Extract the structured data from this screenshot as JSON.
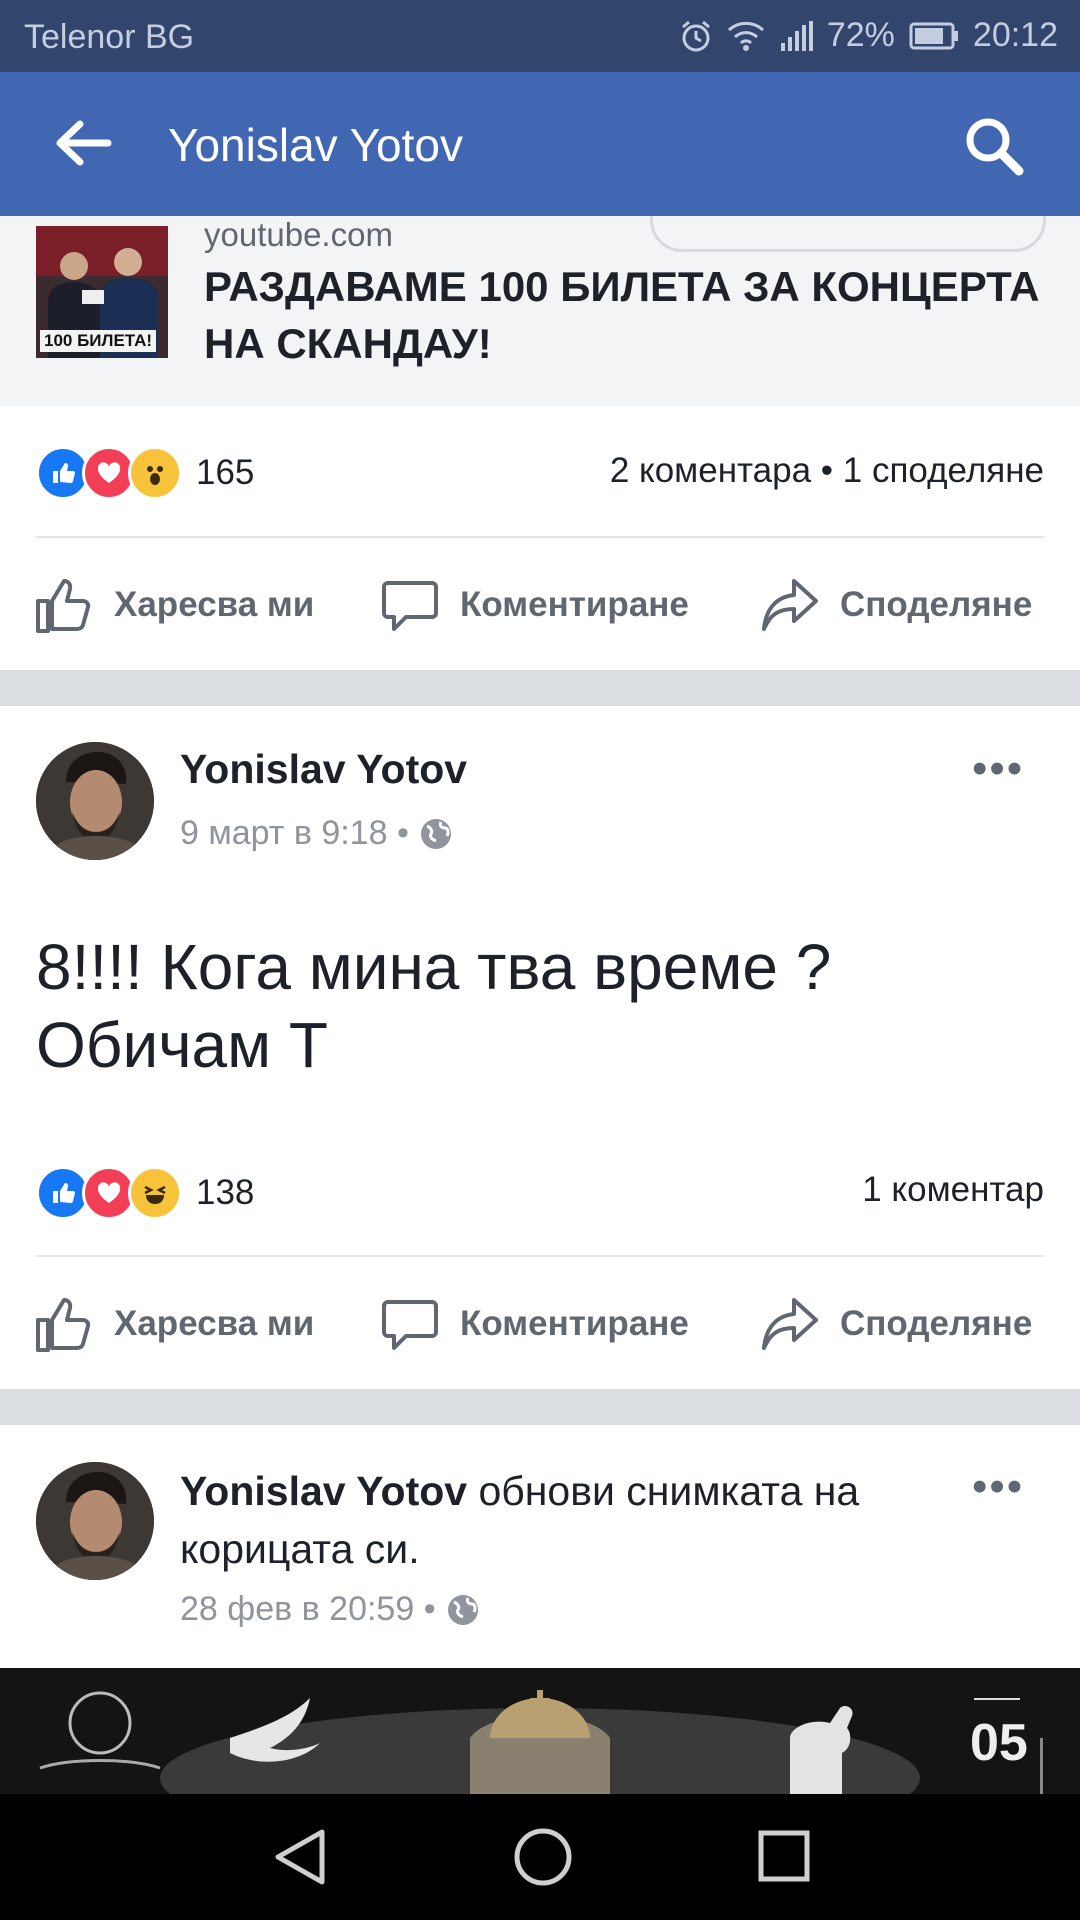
{
  "status_bar": {
    "carrier": "Telenor BG",
    "battery": "72%",
    "time": "20:12",
    "icons": [
      "alarm-icon",
      "wifi-icon",
      "signal-icon",
      "battery-icon"
    ]
  },
  "app_bar": {
    "title": "Yonislav Yotov",
    "back_icon": "back-arrow-icon",
    "search_icon": "search-icon",
    "color": "#4267b2"
  },
  "link_preview": {
    "domain": "youtube.com",
    "headline": "РАЗДАВАМЕ 100 БИЛЕТА ЗА КОНЦЕРТА НА СКАНДАУ!",
    "thumbnail_label": "100 БИЛЕТА!"
  },
  "post1_footer": {
    "reactions": [
      "like",
      "love",
      "wow"
    ],
    "reaction_count": "165",
    "comments_shares": "2 коментара • 1 споделяне"
  },
  "actions": {
    "like": "Харесва ми",
    "comment": "Коментиране",
    "share": "Споделяне"
  },
  "post2": {
    "author": "Yonislav Yotov",
    "time": "9 март в 9:18 •",
    "text_line1": "8!!!! Кога мина тва време ?",
    "text_line2": "Обичам Т",
    "reactions": [
      "like",
      "love",
      "haha"
    ],
    "reaction_count": "138",
    "comments": "1 коментар"
  },
  "post3": {
    "author": "Yonislav Yotov",
    "action": " обнови снимката на корицата си.",
    "time": "28 фев в 20:59 •",
    "cover_text": "05"
  },
  "nav_bar": {
    "icons": [
      "back-triangle-icon",
      "home-circle-icon",
      "recents-square-icon"
    ]
  }
}
